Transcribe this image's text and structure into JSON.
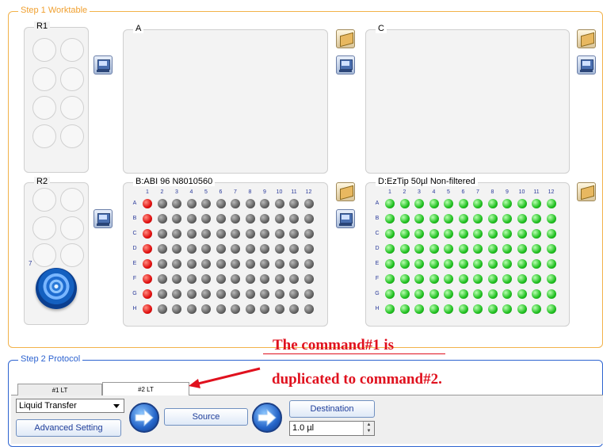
{
  "step1": {
    "legend": "Step 1 Worktable",
    "racks": [
      {
        "id": "R1"
      },
      {
        "id": "R2",
        "slot_number": "7"
      }
    ],
    "slots": {
      "A": {
        "title": "A"
      },
      "B": {
        "title": "B:ABI 96 N8010560"
      },
      "C": {
        "title": "C"
      },
      "D": {
        "title": "D:EzTip 50µl Non-filtered"
      }
    },
    "plate_columns": [
      "1",
      "2",
      "3",
      "4",
      "5",
      "6",
      "7",
      "8",
      "9",
      "10",
      "11",
      "12"
    ],
    "plate_rows": [
      "A",
      "B",
      "C",
      "D",
      "E",
      "F",
      "G",
      "H"
    ],
    "colors": {
      "used_well": "#e01010",
      "empty_well": "#555555",
      "tip_well": "#20c020",
      "step1_border": "#f2b24a",
      "step2_border": "#2d63d0"
    }
  },
  "step2": {
    "legend": "Step 2 Protocol",
    "tabs": [
      {
        "label": "#1 LT"
      },
      {
        "label": "#2 LT",
        "active": true
      }
    ],
    "command_select": "Liquid Transfer",
    "advanced_button": "Advanced Setting",
    "source_button": "Source",
    "destination_button": "Destination",
    "volume": "1.0 µl"
  },
  "annotation": {
    "line1": "The command#1 is",
    "line2": "duplicated to command#2."
  }
}
